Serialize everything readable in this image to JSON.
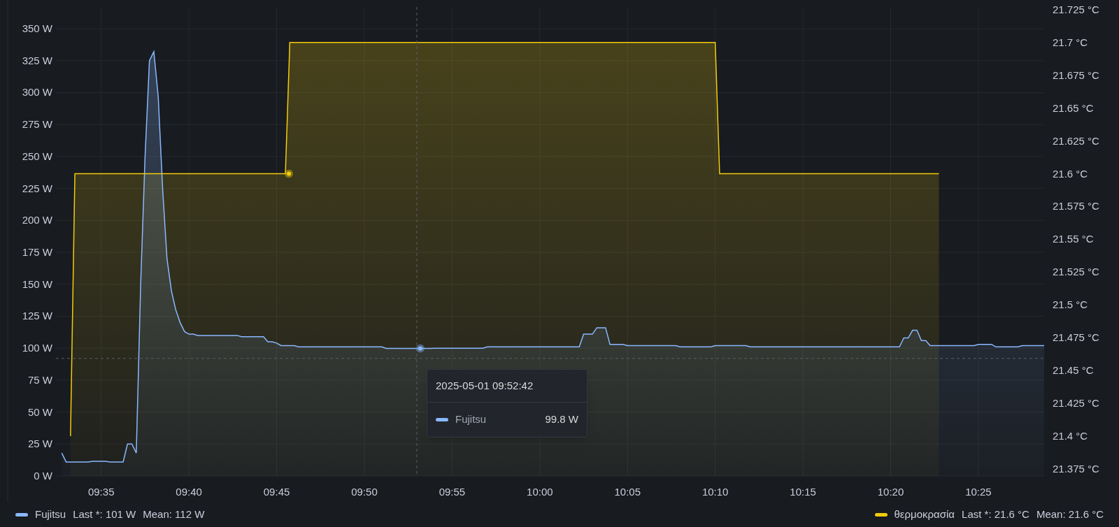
{
  "chart_data": {
    "type": "area",
    "grid": true,
    "ref_lines": [
      {
        "axis": "y",
        "value": 92
      }
    ],
    "categories": [
      null,
      null,
      null,
      null,
      null,
      null,
      null,
      null,
      null,
      null,
      "09:35",
      null,
      null,
      null,
      null,
      null,
      null,
      null,
      null,
      null,
      null,
      null,
      null,
      null,
      null,
      null,
      null,
      null,
      null,
      null,
      "09:40",
      null,
      null,
      null,
      null,
      null,
      null,
      null,
      null,
      null,
      null,
      null,
      null,
      null,
      null,
      null,
      null,
      null,
      null,
      null,
      "09:45",
      null,
      null,
      null,
      null,
      null,
      null,
      null,
      null,
      null,
      null,
      null,
      null,
      null,
      null,
      null,
      null,
      null,
      null,
      null,
      "09:50",
      null,
      null,
      null,
      null,
      null,
      null,
      null,
      null,
      null,
      null,
      null,
      null,
      null,
      null,
      null,
      null,
      null,
      null,
      null,
      "09:55",
      null,
      null,
      null,
      null,
      null,
      null,
      null,
      null,
      null,
      null,
      null,
      null,
      null,
      null,
      null,
      null,
      null,
      null,
      null,
      "10:00",
      null,
      null,
      null,
      null,
      null,
      null,
      null,
      null,
      null,
      null,
      null,
      null,
      null,
      null,
      null,
      null,
      null,
      null,
      null,
      "10:05",
      null,
      null,
      null,
      null,
      null,
      null,
      null,
      null,
      null,
      null,
      null,
      null,
      null,
      null,
      null,
      null,
      null,
      null,
      null,
      "10:10",
      null,
      null,
      null,
      null,
      null,
      null,
      null,
      null,
      null,
      null,
      null,
      null,
      null,
      null,
      null,
      null,
      null,
      null,
      null,
      "10:15",
      null,
      null,
      null,
      null,
      null,
      null,
      null,
      null,
      null,
      null,
      null,
      null,
      null,
      null,
      null,
      null,
      null,
      null,
      null,
      "10:20",
      null,
      null,
      null,
      null,
      null,
      null,
      null,
      null,
      null,
      null,
      null,
      null,
      null,
      null,
      null,
      null,
      null,
      null,
      null,
      "10:25",
      null,
      null,
      null,
      null,
      null,
      null,
      null,
      null,
      null,
      null,
      null,
      null,
      null,
      null,
      null
    ],
    "series": [
      {
        "name": "Fujitsu",
        "color": "#8ab8ff",
        "values": [
          null,
          18,
          11,
          11,
          11,
          11,
          11,
          11,
          11.5,
          11.5,
          11.5,
          11.5,
          11,
          11,
          11,
          11,
          25,
          25,
          18,
          150,
          250,
          325,
          332,
          297,
          225,
          170,
          145,
          130,
          120,
          113,
          111,
          111,
          110,
          110,
          110,
          110,
          110,
          110,
          110,
          110,
          110,
          110,
          109,
          109,
          109,
          109,
          109,
          109,
          105,
          105,
          104,
          102,
          102,
          102,
          102,
          101,
          101,
          101,
          101,
          101,
          101,
          101,
          101,
          101,
          101,
          101,
          101,
          101,
          101,
          101,
          101,
          101,
          101,
          101,
          101,
          99.8,
          99.8,
          99.8,
          99.8,
          99.8,
          99.8,
          99.8,
          99.8,
          99.8,
          99.8,
          99.8,
          100,
          100,
          100,
          100,
          100,
          100,
          100,
          100,
          100,
          100,
          100,
          100,
          101,
          101,
          101,
          101,
          101,
          101,
          101,
          101,
          101,
          101,
          101,
          101,
          101,
          101,
          101,
          101,
          101,
          101,
          101,
          101,
          101,
          101,
          111,
          111,
          111,
          116,
          116,
          116,
          103,
          103,
          103,
          103,
          102,
          102,
          102,
          102,
          102,
          102,
          102,
          102,
          102,
          102,
          102,
          102,
          101,
          101,
          101,
          101,
          101,
          101,
          101,
          101,
          102,
          102,
          102,
          102,
          102,
          102,
          102,
          102,
          101,
          101,
          101,
          101,
          101,
          101,
          101,
          101,
          101,
          101,
          101,
          101,
          101,
          101,
          101,
          101,
          101,
          101,
          101,
          101,
          101,
          101,
          101,
          101,
          101,
          101,
          101,
          101,
          101,
          101,
          101,
          101,
          101,
          101,
          101,
          108,
          108,
          114,
          114,
          106,
          106,
          102,
          102,
          102,
          102,
          102,
          102,
          102,
          102,
          102,
          102,
          102,
          103,
          103,
          103,
          103,
          101,
          101,
          101,
          101,
          101,
          101,
          102,
          102,
          102,
          102,
          102,
          102
        ]
      },
      {
        "name": "θερμοκρασία",
        "color": "#f2cc0c",
        "axis": "y2",
        "values": [
          null,
          null,
          null,
          21.4,
          21.6,
          21.6,
          21.6,
          21.6,
          21.6,
          21.6,
          21.6,
          21.6,
          21.6,
          21.6,
          21.6,
          21.6,
          21.6,
          21.6,
          21.6,
          21.6,
          21.6,
          21.6,
          21.6,
          21.6,
          21.6,
          21.6,
          21.6,
          21.6,
          21.6,
          21.6,
          21.6,
          21.6,
          21.6,
          21.6,
          21.6,
          21.6,
          21.6,
          21.6,
          21.6,
          21.6,
          21.6,
          21.6,
          21.6,
          21.6,
          21.6,
          21.6,
          21.6,
          21.6,
          21.6,
          21.6,
          21.6,
          21.6,
          21.6,
          21.7,
          21.7,
          21.7,
          21.7,
          21.7,
          21.7,
          21.7,
          21.7,
          21.7,
          21.7,
          21.7,
          21.7,
          21.7,
          21.7,
          21.7,
          21.7,
          21.7,
          21.7,
          21.7,
          21.7,
          21.7,
          21.7,
          21.7,
          21.7,
          21.7,
          21.7,
          21.7,
          21.7,
          21.7,
          21.7,
          21.7,
          21.7,
          21.7,
          21.7,
          21.7,
          21.7,
          21.7,
          21.7,
          21.7,
          21.7,
          21.7,
          21.7,
          21.7,
          21.7,
          21.7,
          21.7,
          21.7,
          21.7,
          21.7,
          21.7,
          21.7,
          21.7,
          21.7,
          21.7,
          21.7,
          21.7,
          21.7,
          21.7,
          21.7,
          21.7,
          21.7,
          21.7,
          21.7,
          21.7,
          21.7,
          21.7,
          21.7,
          21.7,
          21.7,
          21.7,
          21.7,
          21.7,
          21.7,
          21.7,
          21.7,
          21.7,
          21.7,
          21.7,
          21.7,
          21.7,
          21.7,
          21.7,
          21.7,
          21.7,
          21.7,
          21.7,
          21.7,
          21.7,
          21.7,
          21.7,
          21.7,
          21.7,
          21.7,
          21.7,
          21.7,
          21.7,
          21.7,
          21.7,
          21.6,
          21.6,
          21.6,
          21.6,
          21.6,
          21.6,
          21.6,
          21.6,
          21.6,
          21.6,
          21.6,
          21.6,
          21.6,
          21.6,
          21.6,
          21.6,
          21.6,
          21.6,
          21.6,
          21.6,
          21.6,
          21.6,
          21.6,
          21.6,
          21.6,
          21.6,
          21.6,
          21.6,
          21.6,
          21.6,
          21.6,
          21.6,
          21.6,
          21.6,
          21.6,
          21.6,
          21.6,
          21.6,
          21.6,
          21.6,
          21.6,
          21.6,
          21.6,
          21.6,
          21.6,
          21.6,
          21.6,
          21.6,
          21.6,
          21.6,
          21.6,
          null,
          null,
          null,
          null,
          null,
          null,
          null,
          null,
          null,
          null,
          null,
          null,
          null,
          null,
          null,
          null,
          null,
          null,
          null,
          null,
          null,
          null,
          null,
          null
        ]
      }
    ],
    "ylim": [
      0,
      367
    ],
    "yticks": [
      {
        "value": 0,
        "label": "0 W"
      },
      {
        "value": 25,
        "label": "25 W"
      },
      {
        "value": 50,
        "label": "50 W"
      },
      {
        "value": 75,
        "label": "75 W"
      },
      {
        "value": 100,
        "label": "100 W"
      },
      {
        "value": 125,
        "label": "125 W"
      },
      {
        "value": 150,
        "label": "150 W"
      },
      {
        "value": 175,
        "label": "175 W"
      },
      {
        "value": 200,
        "label": "200 W"
      },
      {
        "value": 225,
        "label": "225 W"
      },
      {
        "value": 250,
        "label": "250 W"
      },
      {
        "value": 275,
        "label": "275 W"
      },
      {
        "value": 300,
        "label": "300 W"
      },
      {
        "value": 325,
        "label": "325 W"
      },
      {
        "value": 350,
        "label": "350 W"
      }
    ],
    "y2lim": [
      21.3697,
      21.727
    ],
    "y2ticks": [
      {
        "value": 21.375,
        "label": "21.375 °C"
      },
      {
        "value": 21.4,
        "label": "21.4 °C"
      },
      {
        "value": 21.425,
        "label": "21.425 °C"
      },
      {
        "value": 21.45,
        "label": "21.45 °C"
      },
      {
        "value": 21.475,
        "label": "21.475 °C"
      },
      {
        "value": 21.5,
        "label": "21.5 °C"
      },
      {
        "value": 21.525,
        "label": "21.525 °C"
      },
      {
        "value": 21.55,
        "label": "21.55 °C"
      },
      {
        "value": 21.575,
        "label": "21.575 °C"
      },
      {
        "value": 21.6,
        "label": "21.6 °C"
      },
      {
        "value": 21.625,
        "label": "21.625 °C"
      },
      {
        "value": 21.65,
        "label": "21.65 °C"
      },
      {
        "value": 21.675,
        "label": "21.675 °C"
      },
      {
        "value": 21.7,
        "label": "21.7 °C"
      },
      {
        "value": 21.725,
        "label": "21.725 °C"
      }
    ]
  },
  "tooltip": {
    "time": "2025-05-01 09:52:42",
    "series": "Fujitsu",
    "value": "99.8 W"
  },
  "legend": [
    {
      "last": "Last *: 101 W",
      "mean": "Mean: 112 W"
    },
    {
      "last": "Last *: 21.6 °C",
      "mean": "Mean: 21.6 °C"
    }
  ]
}
